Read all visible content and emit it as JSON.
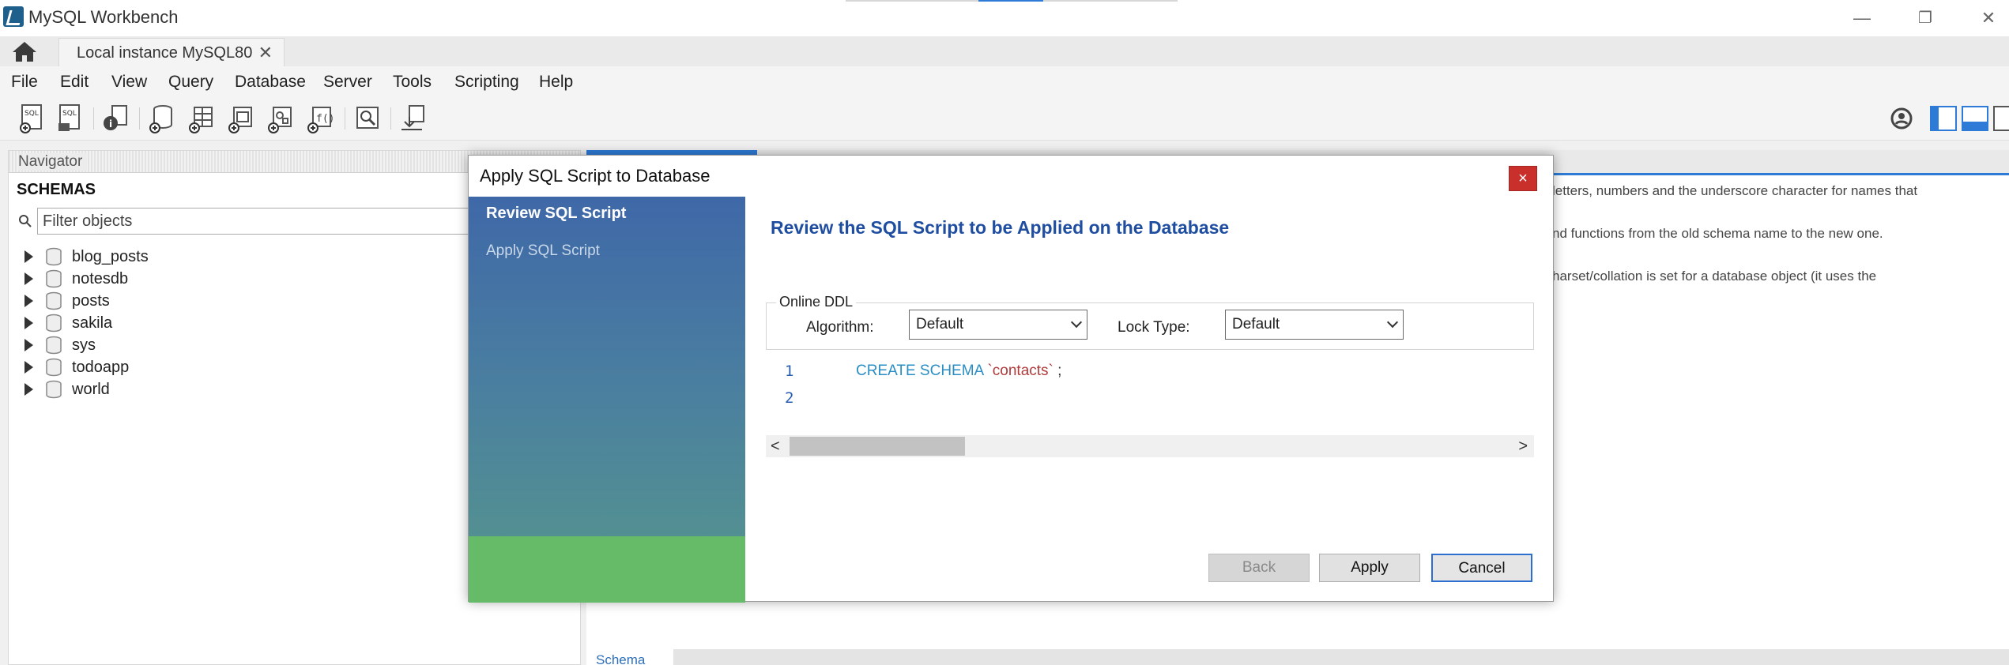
{
  "window": {
    "app_title": "MySQL Workbench",
    "controls": {
      "minimize": "—",
      "restore": "❐",
      "close": "✕"
    }
  },
  "tabs": {
    "home_icon": "home-icon",
    "instance_tab_label": "Local instance MySQL80",
    "instance_tab_close": "✕"
  },
  "menu": [
    "File",
    "Edit",
    "View",
    "Query",
    "Database",
    "Server",
    "Tools",
    "Scripting",
    "Help"
  ],
  "navigator": {
    "header": "Navigator",
    "schemas_label": "SCHEMAS",
    "filter_placeholder": "Filter objects",
    "schemas": [
      "blog_posts",
      "notesdb",
      "posts",
      "sakila",
      "sys",
      "todoapp",
      "world"
    ]
  },
  "background": {
    "lines": [
      "letters, numbers and the underscore character for names that",
      "nd functions from the old schema name to the new one.",
      "harset/collation is set for a database object (it uses the"
    ],
    "schema_link": "Schema"
  },
  "dialog": {
    "title": "Apply SQL Script to Database",
    "close": "×",
    "steps": {
      "current": "Review SQL Script",
      "next": "Apply SQL Script"
    },
    "heading": "Review the SQL Script to be Applied on the Database",
    "ddl": {
      "legend": "Online DDL",
      "algorithm_label": "Algorithm:",
      "algorithm_value": "Default",
      "lock_label": "Lock Type:",
      "lock_value": "Default"
    },
    "script": {
      "line1_no": "1",
      "line2_no": "2",
      "keyword": "CREATE SCHEMA ",
      "identifier": "`contacts`",
      "terminator": " ;"
    },
    "scroll": {
      "left": "<",
      "right": ">"
    },
    "buttons": {
      "back": "Back",
      "apply": "Apply",
      "cancel": "Cancel"
    }
  }
}
